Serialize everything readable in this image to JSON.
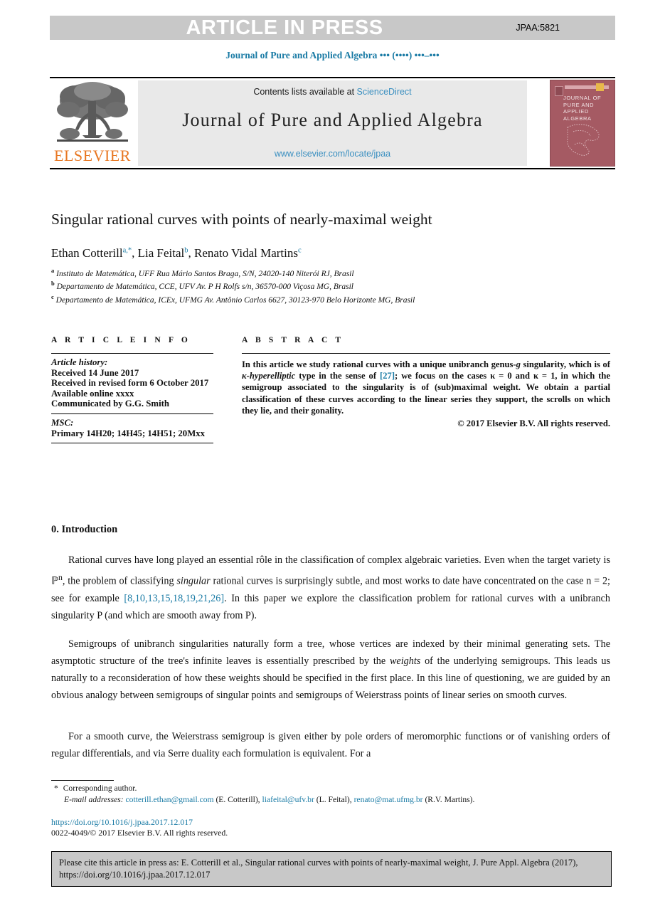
{
  "banner": {
    "press_label": "ARTICLE IN PRESS",
    "article_code": "JPAA:5821",
    "banner_color": "#c8c8c8"
  },
  "running_head": {
    "journal": "Journal of Pure and Applied Algebra",
    "volume_placeholder": "••• (••••) •••–•••",
    "color": "#1a7ba5"
  },
  "masthead": {
    "publisher": "ELSEVIER",
    "publisher_color": "#e87722",
    "contents_prefix": "Contents lists available at ",
    "contents_link": "ScienceDirect",
    "journal_title": "Journal of Pure and Applied Algebra",
    "journal_url": "www.elsevier.com/locate/jpaa",
    "link_color": "#3a8fc0",
    "cover": {
      "line1": "JOURNAL OF",
      "line2": "PURE AND",
      "line3": "APPLIED ALGEBRA",
      "background": "#a55a63"
    }
  },
  "article": {
    "title": "Singular rational curves with points of nearly-maximal weight",
    "authors": [
      {
        "name": "Ethan Cotterill",
        "marks": "a,*"
      },
      {
        "name": "Lia Feital",
        "marks": "b"
      },
      {
        "name": "Renato Vidal Martins",
        "marks": "c"
      }
    ],
    "affiliations": [
      {
        "mark": "a",
        "text": "Instituto de Matemática, UFF Rua Mário Santos Braga, S/N, 24020-140 Niterói RJ, Brasil"
      },
      {
        "mark": "b",
        "text": "Departamento de Matemática, CCE, UFV Av. P H Rolfs s/n, 36570-000 Viçosa MG, Brasil"
      },
      {
        "mark": "c",
        "text": "Departamento de Matemática, ICEx, UFMG Av. Antônio Carlos 6627, 30123-970 Belo Horizonte MG, Brasil"
      }
    ]
  },
  "article_info": {
    "kicker": "A R T I C L E   I N F O",
    "history_label": "Article history:",
    "history_lines": [
      "Received 14 June 2017",
      "Received in revised form 6 October 2017",
      "Available online xxxx",
      "Communicated by G.G. Smith"
    ],
    "msc_label": "MSC:",
    "msc_lines": [
      "Primary 14H20; 14H45; 14H51; 20Mxx"
    ]
  },
  "abstract": {
    "kicker": "A B S T R A C T",
    "text_part1": "In this article we study rational curves with a unique unibranch genus-",
    "genus_symbol": "g",
    "text_part2": " singularity, which is of ",
    "italic_term": "κ-hyperelliptic",
    "text_part3": " type in the sense of ",
    "citation": "[27]",
    "text_part4": "; we focus on the cases κ = 0 and κ = 1, in which the semigroup associated to the singularity is of (sub)maximal weight. We obtain a partial classification of these curves according to the linear series they support, the scrolls on which they lie, and their gonality.",
    "copyright": "© 2017 Elsevier B.V. All rights reserved."
  },
  "introduction": {
    "heading": "0. Introduction",
    "paragraph1_a": "Rational curves have long played an essential rôle in the classification of complex algebraic varieties. Even when the target variety is ℙ",
    "paragraph1_sup": "n",
    "paragraph1_b": ", the problem of classifying ",
    "paragraph1_italic": "singular",
    "paragraph1_c": " rational curves is surprisingly subtle, and most works to date have concentrated on the case n = 2; see for example ",
    "paragraph1_cite": "[8,10,13,15,18,19,21,26]",
    "paragraph1_d": ". In this paper we explore the classification problem for rational curves with a unibranch singularity P (and which are smooth away from P).",
    "paragraph2_a": "Semigroups of unibranch singularities naturally form a tree, whose vertices are indexed by their minimal generating sets. The asymptotic structure of the tree's infinite leaves is essentially prescribed by the ",
    "paragraph2_italic": "weights",
    "paragraph2_b": " of the underlying semigroups. This leads us naturally to a reconsideration of how these weights should be specified in the first place. In this line of questioning, we are guided by an obvious analogy between semigroups of singular points and semigroups of Weierstrass points of linear series on smooth curves.",
    "paragraph3": "For a smooth curve, the Weierstrass semigroup is given either by pole orders of meromorphic functions or of vanishing orders of regular differentials, and via Serre duality each formulation is equivalent. For a"
  },
  "footnotes": {
    "corresponding": "Corresponding author.",
    "email_label": "E-mail addresses:",
    "emails": [
      {
        "address": "cotterill.ethan@gmail.com",
        "owner": "(E. Cotterill),"
      },
      {
        "address": "liafeital@ufv.br",
        "owner": "(L. Feital),"
      },
      {
        "address": "renato@mat.ufmg.br",
        "owner": "(R.V. Martins)."
      }
    ],
    "doi": "https://doi.org/10.1016/j.jpaa.2017.12.017",
    "issn_line": "0022-4049/© 2017 Elsevier B.V. All rights reserved."
  },
  "cite_box": {
    "text": "Please cite this article in press as: E. Cotterill et al., Singular rational curves with points of nearly-maximal weight, J. Pure Appl. Algebra (2017), https://doi.org/10.1016/j.jpaa.2017.12.017",
    "background": "#c8c8c8"
  }
}
